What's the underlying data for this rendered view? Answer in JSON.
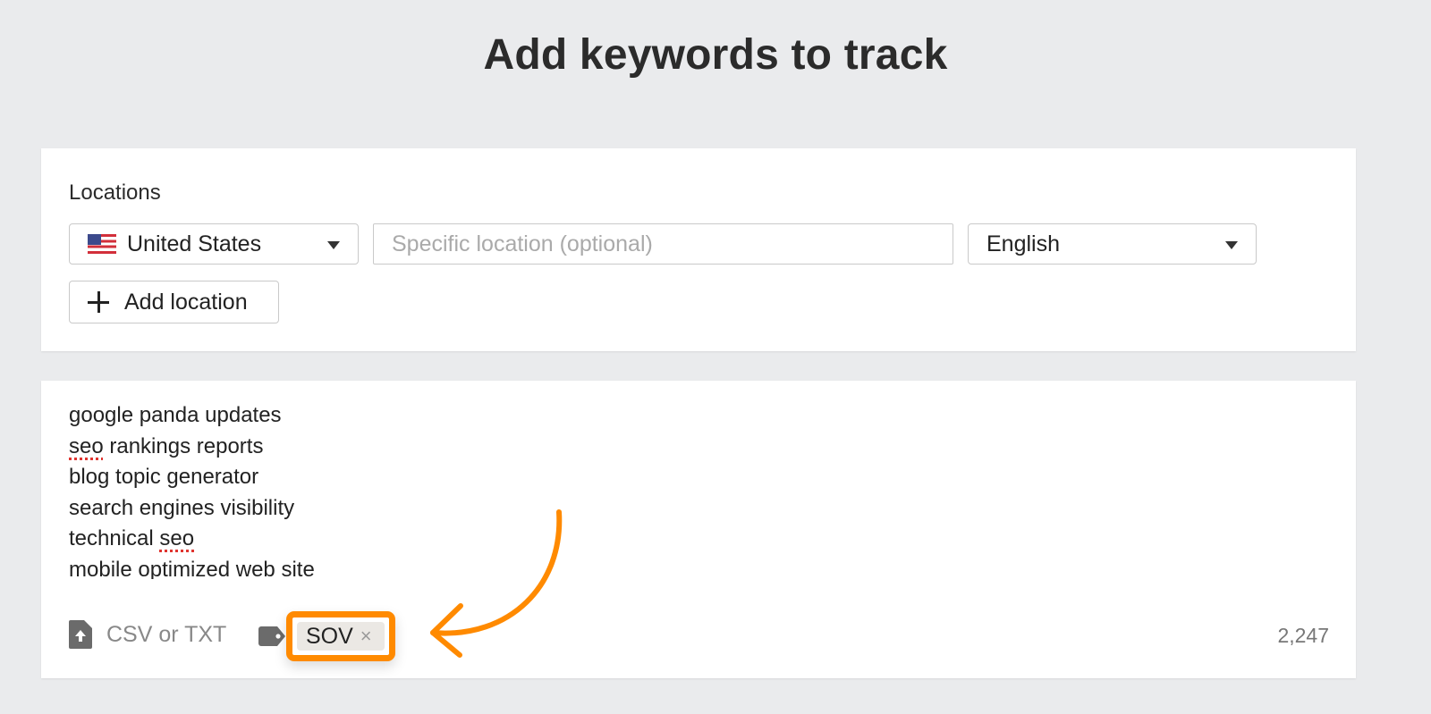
{
  "page": {
    "title": "Add keywords to track"
  },
  "locations": {
    "label": "Locations",
    "country": {
      "value": "United States",
      "flag_icon": "us-flag-icon"
    },
    "specific_location": {
      "value": "",
      "placeholder": "Specific location (optional)"
    },
    "language": {
      "value": "English"
    },
    "add_location_label": "Add location"
  },
  "keywords": {
    "lines": [
      {
        "parts": [
          {
            "text": "google panda updates",
            "misspelled": false
          }
        ]
      },
      {
        "parts": [
          {
            "text": "seo",
            "misspelled": true
          },
          {
            "text": " rankings reports",
            "misspelled": false
          }
        ]
      },
      {
        "parts": [
          {
            "text": "blog topic generator",
            "misspelled": false
          }
        ]
      },
      {
        "parts": [
          {
            "text": "search engines visibility",
            "misspelled": false
          }
        ]
      },
      {
        "parts": [
          {
            "text": "technical ",
            "misspelled": false
          },
          {
            "text": "seo",
            "misspelled": true
          }
        ]
      },
      {
        "parts": [
          {
            "text": "mobile optimized web site",
            "misspelled": false
          }
        ]
      }
    ],
    "upload_label": "CSV or TXT",
    "tag": {
      "label": "SOV",
      "remove_glyph": "×"
    },
    "count": "2,247"
  },
  "annotation": {
    "highlight_color": "#ff8a00"
  },
  "colors": {
    "background": "#eaebed",
    "card": "#ffffff",
    "accent": "#ff8a00",
    "spellcheck": "#e0342f"
  }
}
